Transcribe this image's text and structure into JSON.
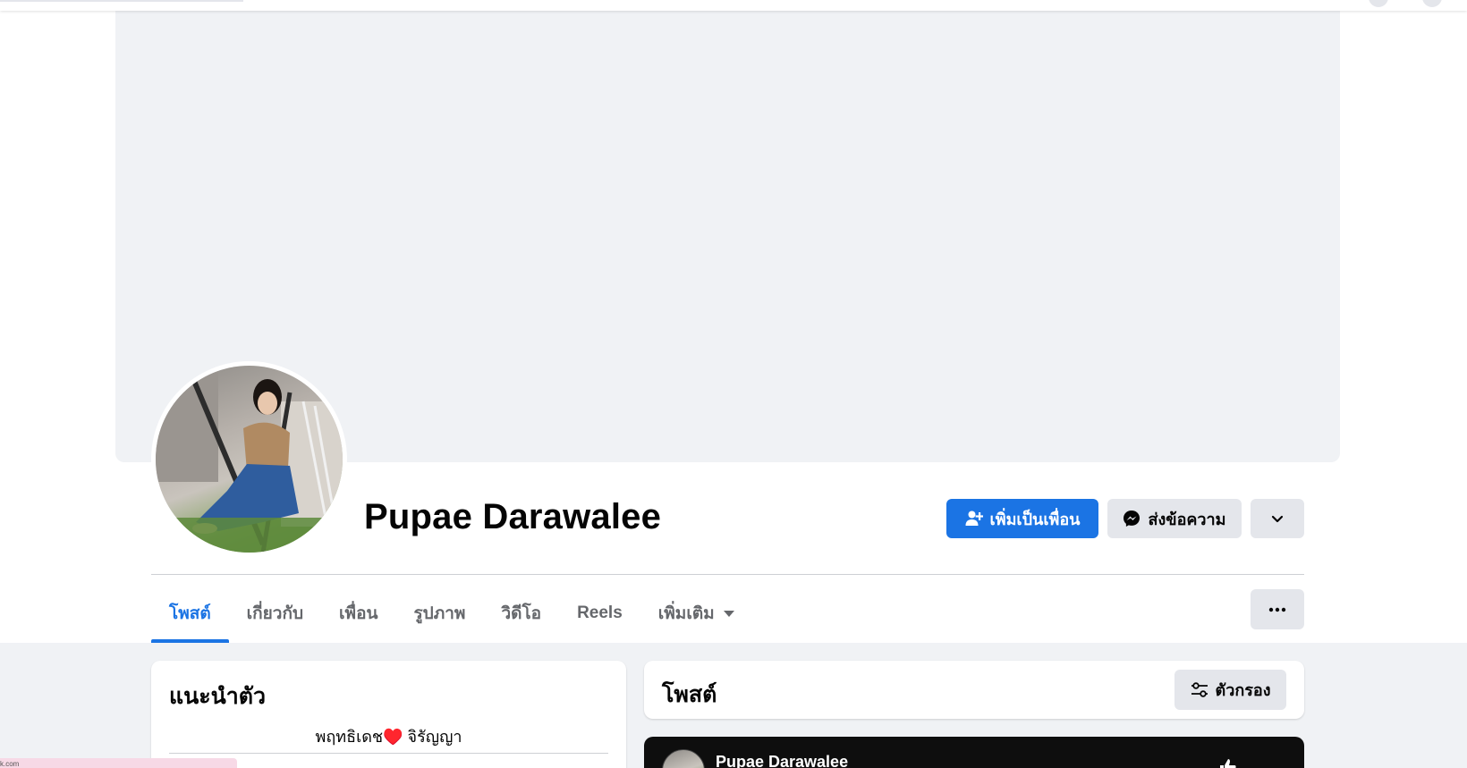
{
  "profile": {
    "name": "Pupae Darawalee",
    "add_friend_label": "เพิ่มเป็นเพื่อน",
    "message_label": "ส่งข้อความ"
  },
  "tabs": [
    {
      "label": "โพสต์",
      "active": true
    },
    {
      "label": "เกี่ยวกับ",
      "active": false
    },
    {
      "label": "เพื่อน",
      "active": false
    },
    {
      "label": "รูปภาพ",
      "active": false
    },
    {
      "label": "วิดีโอ",
      "active": false
    },
    {
      "label": "Reels",
      "active": false
    },
    {
      "label": "เพิ่มเติม",
      "active": false
    }
  ],
  "intro": {
    "title": "แนะนำตัว",
    "bio": "พฤทธิเดช♥️ จิรัญญา"
  },
  "posts": {
    "title": "โพสต์",
    "filter_label": "ตัวกรอง",
    "preview_author": "Pupae Darawalee"
  },
  "bottom_bar": {
    "text": "k.com"
  },
  "colors": {
    "accent": "#1b74e4",
    "cover": "#f0f2f5",
    "secondary_button": "#e4e6eb",
    "text_secondary": "#65676b"
  },
  "icons": {
    "add_friend": "person-plus-icon",
    "message": "messenger-icon",
    "more": "chevron-down-icon",
    "tab_more": "ellipsis-icon",
    "filter": "sliders-icon"
  }
}
